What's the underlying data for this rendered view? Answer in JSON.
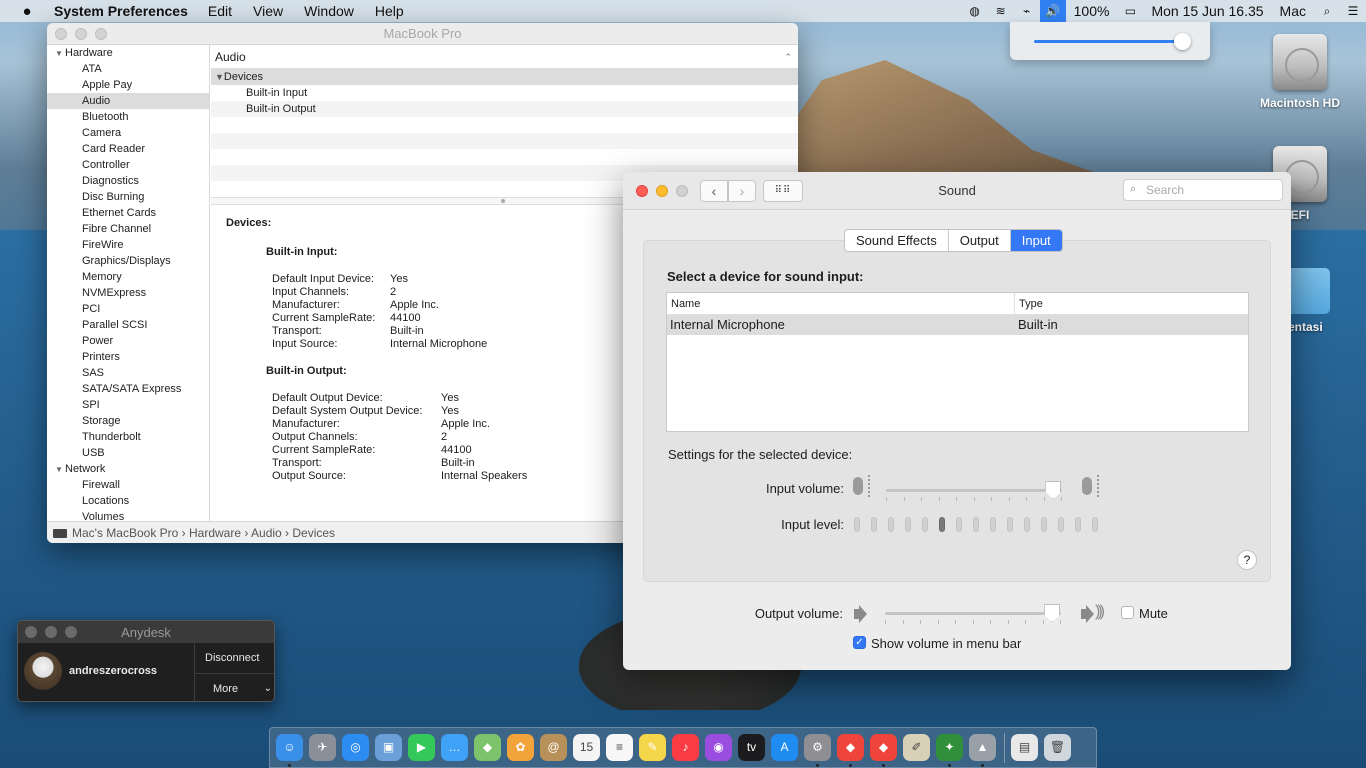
{
  "menubar": {
    "app_name": "System Preferences",
    "items": [
      "Edit",
      "View",
      "Window",
      "Help"
    ],
    "battery": "100%",
    "clock": "Mon 15 Jun  16.35",
    "user": "Mac"
  },
  "volume_popup": {
    "level": 0.95
  },
  "desktop": {
    "icons": [
      {
        "label": "Macintosh HD"
      },
      {
        "label": "EFI"
      },
      {
        "label": "mentasi"
      }
    ]
  },
  "sysinfo": {
    "window_title": "MacBook Pro",
    "sidebar": {
      "hardware_label": "Hardware",
      "hardware_items": [
        "ATA",
        "Apple Pay",
        "Audio",
        "Bluetooth",
        "Camera",
        "Card Reader",
        "Controller",
        "Diagnostics",
        "Disc Burning",
        "Ethernet Cards",
        "Fibre Channel",
        "FireWire",
        "Graphics/Displays",
        "Memory",
        "NVMExpress",
        "PCI",
        "Parallel SCSI",
        "Power",
        "Printers",
        "SAS",
        "SATA/SATA Express",
        "SPI",
        "Storage",
        "Thunderbolt",
        "USB"
      ],
      "selected": "Audio",
      "network_label": "Network",
      "network_items": [
        "Firewall",
        "Locations",
        "Volumes"
      ]
    },
    "header": "Audio",
    "tree": {
      "group": "Devices",
      "children": [
        "Built-in Input",
        "Built-in Output"
      ]
    },
    "detail": {
      "title": "Devices:",
      "input": {
        "title": "Built-in Input:",
        "rows": [
          {
            "k": "Default Input Device:",
            "v": "Yes"
          },
          {
            "k": "Input Channels:",
            "v": "2"
          },
          {
            "k": "Manufacturer:",
            "v": "Apple Inc."
          },
          {
            "k": "Current SampleRate:",
            "v": "44100"
          },
          {
            "k": "Transport:",
            "v": "Built-in"
          },
          {
            "k": "Input Source:",
            "v": "Internal Microphone"
          }
        ]
      },
      "output": {
        "title": "Built-in Output:",
        "rows": [
          {
            "k": "Default Output Device:",
            "v": "Yes"
          },
          {
            "k": "Default System Output Device:",
            "v": "Yes"
          },
          {
            "k": "Manufacturer:",
            "v": "Apple Inc."
          },
          {
            "k": "Output Channels:",
            "v": "2"
          },
          {
            "k": "Current SampleRate:",
            "v": "44100"
          },
          {
            "k": "Transport:",
            "v": "Built-in"
          },
          {
            "k": "Output Source:",
            "v": "Internal Speakers"
          }
        ]
      }
    },
    "status_path": "Mac's MacBook Pro › Hardware  › Audio  › Devices"
  },
  "sound": {
    "title": "Sound",
    "search_placeholder": "Search",
    "tabs": [
      "Sound Effects",
      "Output",
      "Input"
    ],
    "active_tab": "Input",
    "heading": "Select a device for sound input:",
    "columns": [
      "Name",
      "Type"
    ],
    "devices": [
      {
        "name": "Internal Microphone",
        "type": "Built-in"
      }
    ],
    "settings_label": "Settings for the selected device:",
    "input_volume_label": "Input volume:",
    "input_volume": 0.95,
    "input_level_label": "Input level:",
    "input_level": 0.4,
    "help_label": "?",
    "output_volume_label": "Output volume:",
    "output_volume": 0.95,
    "mute_label": "Mute",
    "mute_checked": false,
    "show_volume_label": "Show volume in menu bar",
    "show_volume_checked": true
  },
  "anydesk": {
    "title": "Anydesk",
    "user": "andreszerocross",
    "disconnect_label": "Disconnect",
    "more_label": "More"
  },
  "dock": {
    "apps": [
      {
        "name": "finder-icon",
        "color": "#3a8fe8",
        "glyph": "☺",
        "running": true
      },
      {
        "name": "launchpad-icon",
        "color": "#8a8f99",
        "glyph": "✈",
        "running": false
      },
      {
        "name": "safari-icon",
        "color": "#2d8cf0",
        "glyph": "◎",
        "running": false
      },
      {
        "name": "preview-icon",
        "color": "#6a9fd8",
        "glyph": "▣",
        "running": false
      },
      {
        "name": "facetime-icon",
        "color": "#34c759",
        "glyph": "▶",
        "running": false
      },
      {
        "name": "messages-icon",
        "color": "#3fa2f7",
        "glyph": "…",
        "running": false
      },
      {
        "name": "maps-icon",
        "color": "#7cc36b",
        "glyph": "◆",
        "running": false
      },
      {
        "name": "photos-icon",
        "color": "#f2a33a",
        "glyph": "✿",
        "running": false
      },
      {
        "name": "contacts-icon",
        "color": "#b8905a",
        "glyph": "@",
        "running": false
      },
      {
        "name": "calendar-icon",
        "color": "#f4f4f4",
        "glyph": "15",
        "running": false
      },
      {
        "name": "reminders-icon",
        "color": "#f7f7f7",
        "glyph": "≡",
        "running": false
      },
      {
        "name": "notes-icon",
        "color": "#f5d54a",
        "glyph": "✎",
        "running": false
      },
      {
        "name": "music-icon",
        "color": "#fc3c44",
        "glyph": "♪",
        "running": false
      },
      {
        "name": "podcasts-icon",
        "color": "#9b4de0",
        "glyph": "◉",
        "running": false
      },
      {
        "name": "tv-icon",
        "color": "#1c1c1e",
        "glyph": "tv",
        "running": false
      },
      {
        "name": "app-store-icon",
        "color": "#1f8cf2",
        "glyph": "A",
        "running": false
      },
      {
        "name": "system-preferences-icon",
        "color": "#8e8e93",
        "glyph": "⚙",
        "running": true
      },
      {
        "name": "anydesk-icon",
        "color": "#ef443b",
        "glyph": "◆",
        "running": true
      },
      {
        "name": "anydesk-alt-icon",
        "color": "#ef443b",
        "glyph": "◆",
        "running": true
      },
      {
        "name": "script-editor-icon",
        "color": "#d9d0b8",
        "glyph": "✐",
        "running": false
      },
      {
        "name": "activity-icon",
        "color": "#2f8f3a",
        "glyph": "✦",
        "running": true
      },
      {
        "name": "system-info-icon",
        "color": "#9aa0a8",
        "glyph": "▲",
        "running": true
      }
    ],
    "right": [
      {
        "name": "document-icon",
        "color": "#e8e8e8",
        "glyph": "▤"
      },
      {
        "name": "trash-icon",
        "color": "#cfd6dc",
        "glyph": "🗑"
      }
    ]
  }
}
